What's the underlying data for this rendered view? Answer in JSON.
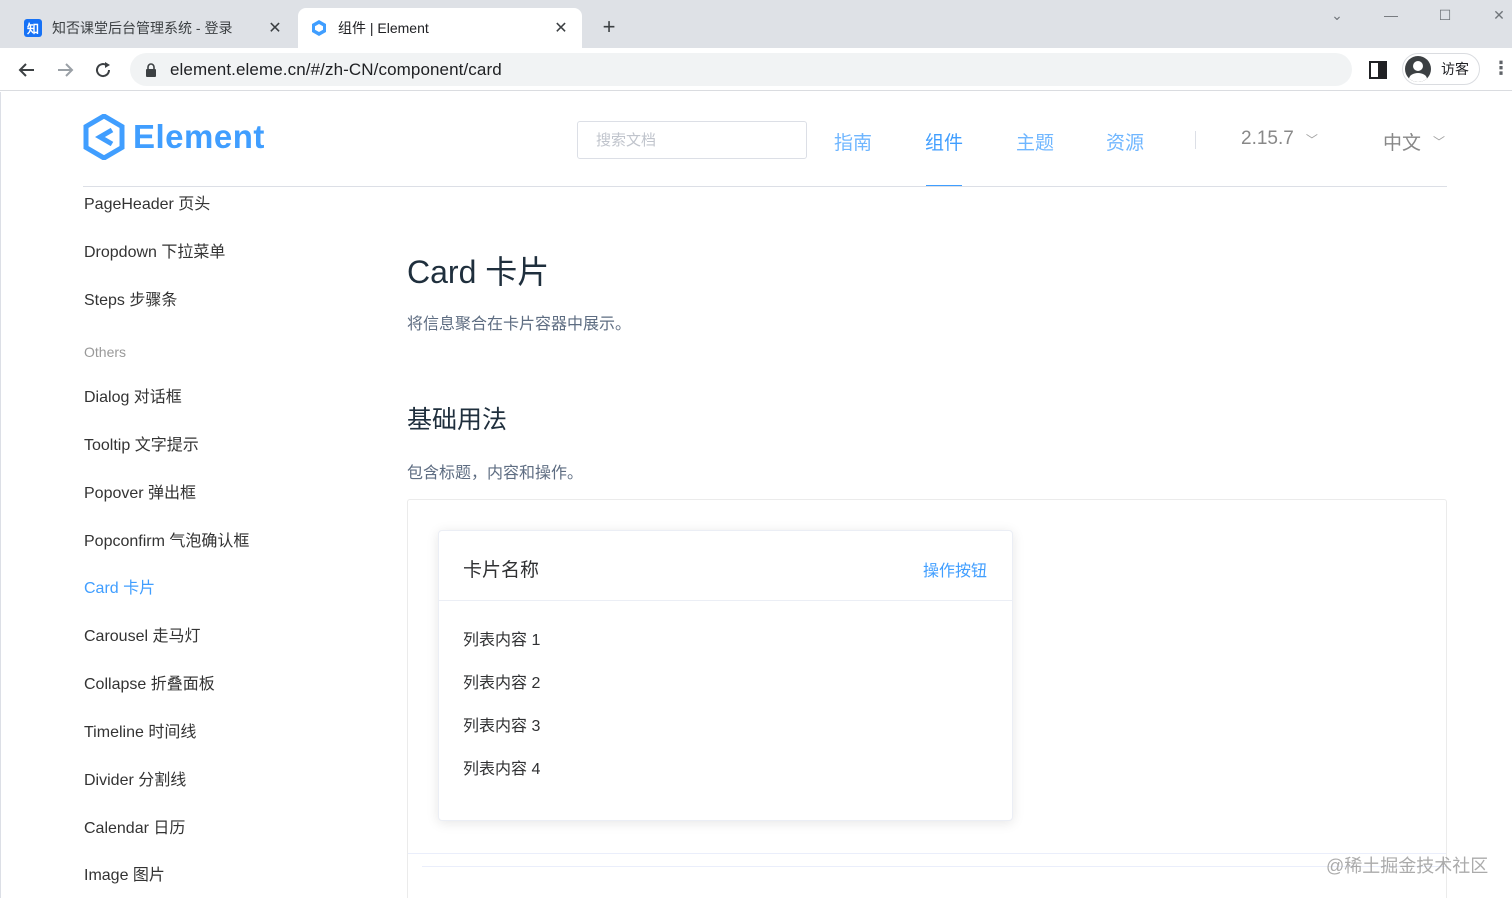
{
  "browser": {
    "tabs": [
      {
        "favicon": "知",
        "title": "知否课堂后台管理系统 - 登录"
      },
      {
        "favicon": "element-logo-icon",
        "title": "组件 | Element"
      }
    ],
    "url": "element.eleme.cn/#/zh-CN/component/card",
    "profile_label": "访客"
  },
  "header": {
    "logo_text": "Element",
    "search_placeholder": "搜索文档",
    "nav": [
      "指南",
      "组件",
      "主题",
      "资源"
    ],
    "active_nav": "组件",
    "version": "2.15.7",
    "language": "中文"
  },
  "sidebar": {
    "items_top": [
      "PageHeader 页头",
      "Dropdown 下拉菜单",
      "Steps 步骤条"
    ],
    "group_label": "Others",
    "items_others": [
      "Dialog 对话框",
      "Tooltip 文字提示",
      "Popover 弹出框",
      "Popconfirm 气泡确认框",
      "Card 卡片",
      "Carousel 走马灯",
      "Collapse 折叠面板",
      "Timeline 时间线",
      "Divider 分割线",
      "Calendar 日历",
      "Image 图片"
    ],
    "active_item": "Card 卡片"
  },
  "content": {
    "title": "Card 卡片",
    "lead": "将信息聚合在卡片容器中展示。",
    "section_title": "基础用法",
    "section_desc": "包含标题，内容和操作。",
    "card": {
      "title": "卡片名称",
      "action": "操作按钮",
      "rows": [
        "列表内容 1",
        "列表内容 2",
        "列表内容 3",
        "列表内容 4"
      ]
    }
  },
  "watermark": "@稀土掘金技术社区",
  "colors": {
    "primary": "#409eff",
    "text": "#303133",
    "muted": "#5e6d82"
  }
}
